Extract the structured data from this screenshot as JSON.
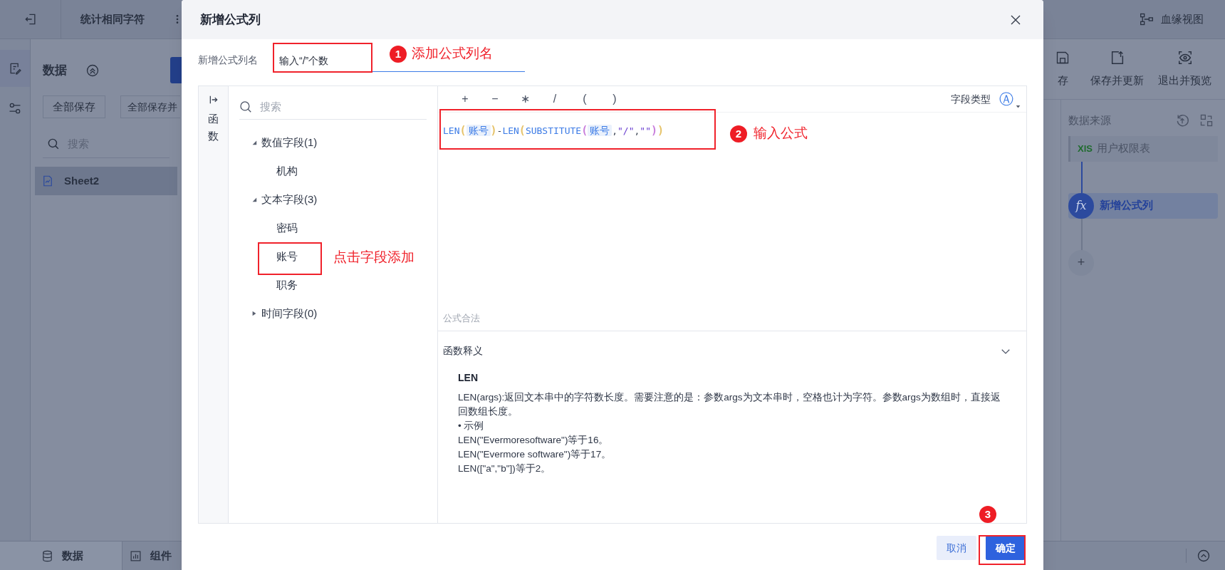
{
  "app": {
    "top_bar": {
      "title": "统计相同字符",
      "lineage": "血缘视图"
    },
    "left_panel": {
      "title": "数据",
      "buttons": [
        "全部保存",
        "全部保存并"
      ],
      "search": {
        "placeholder": "搜索"
      },
      "sheets": [
        {
          "label": "Sheet2",
          "selected": true
        }
      ]
    },
    "toolbar": [
      "存",
      "保存并更新",
      "退出并预览"
    ],
    "data_flow": {
      "title": "数据来源",
      "nodes": [
        {
          "kind": "source",
          "badge": "XlS",
          "label": "用户权限表",
          "selected": false
        },
        {
          "kind": "formula",
          "badge": "fx",
          "label": "新增公式列",
          "selected": true
        },
        {
          "kind": "add",
          "badge": "+",
          "selected": false
        }
      ]
    },
    "bottom_tabs": [
      {
        "label": "数据",
        "selected": true
      },
      {
        "label": "组件",
        "selected": false
      }
    ]
  },
  "dialog": {
    "title": "新增公式列",
    "name_label": "新增公式列名",
    "name_value": "输入“/”个数",
    "side_tab": "函数",
    "fields": {
      "search": {
        "placeholder": "搜索"
      },
      "groups": [
        {
          "label": "数值字段(1)",
          "expanded": true,
          "children": [
            {
              "label": "机构"
            }
          ]
        },
        {
          "label": "文本字段(3)",
          "expanded": true,
          "children": [
            {
              "label": "密码"
            },
            {
              "label": "账号"
            },
            {
              "label": "职务"
            }
          ]
        },
        {
          "label": "时间字段(0)",
          "expanded": false
        }
      ]
    },
    "editor": {
      "operators": [
        "+",
        "−",
        "∗",
        "/",
        "(",
        ")"
      ],
      "field_type_label": "字段类型",
      "field_type_icon": "Ⓐ",
      "formula": [
        {
          "kind": "func",
          "text": "LEN"
        },
        {
          "kind": "paren",
          "text": "(",
          "color": "#e6c36a"
        },
        {
          "kind": "field",
          "text": "账号"
        },
        {
          "kind": "paren",
          "text": ")",
          "color": "#e6c36a"
        },
        {
          "kind": "op",
          "text": "-"
        },
        {
          "kind": "func",
          "text": "LEN"
        },
        {
          "kind": "paren",
          "text": "(",
          "color": "#e6c36a"
        },
        {
          "kind": "func",
          "text": "SUBSTITUTE"
        },
        {
          "kind": "paren",
          "text": "(",
          "color": "#c97fdc"
        },
        {
          "kind": "field",
          "text": "账号"
        },
        {
          "kind": "op",
          "text": ","
        },
        {
          "kind": "string",
          "text": "\"/\""
        },
        {
          "kind": "op",
          "text": ","
        },
        {
          "kind": "string",
          "text": "\"\""
        },
        {
          "kind": "paren",
          "text": ")",
          "color": "#c97fdc"
        },
        {
          "kind": "paren",
          "text": ")",
          "color": "#e6c36a"
        }
      ],
      "status": "公式合法"
    },
    "doc": {
      "header": "函数释义",
      "expanded": true,
      "name": "LEN",
      "lines": [
        "LEN(args):返回文本串中的字符数长度。需要注意的是：参数args为文本串时，空格也计为字符。参数args为数组时，直接返回数组长度。",
        "• 示例",
        "LEN(\"Evermoresoftware\")等于16。",
        "LEN(\"Evermore software\")等于17。",
        "LEN([\"a\",\"b\"])等于2。"
      ]
    },
    "buttons": [
      {
        "kind": "secondary",
        "label": "取消"
      },
      {
        "kind": "primary",
        "label": "确定"
      }
    ]
  },
  "annotations": [
    {
      "kind": "step",
      "number": "1",
      "label": "添加公式列名"
    },
    {
      "kind": "step",
      "number": "2",
      "label": "输入公式"
    },
    {
      "kind": "note",
      "label": "点击字段添加"
    },
    {
      "kind": "step",
      "number": "3"
    }
  ]
}
